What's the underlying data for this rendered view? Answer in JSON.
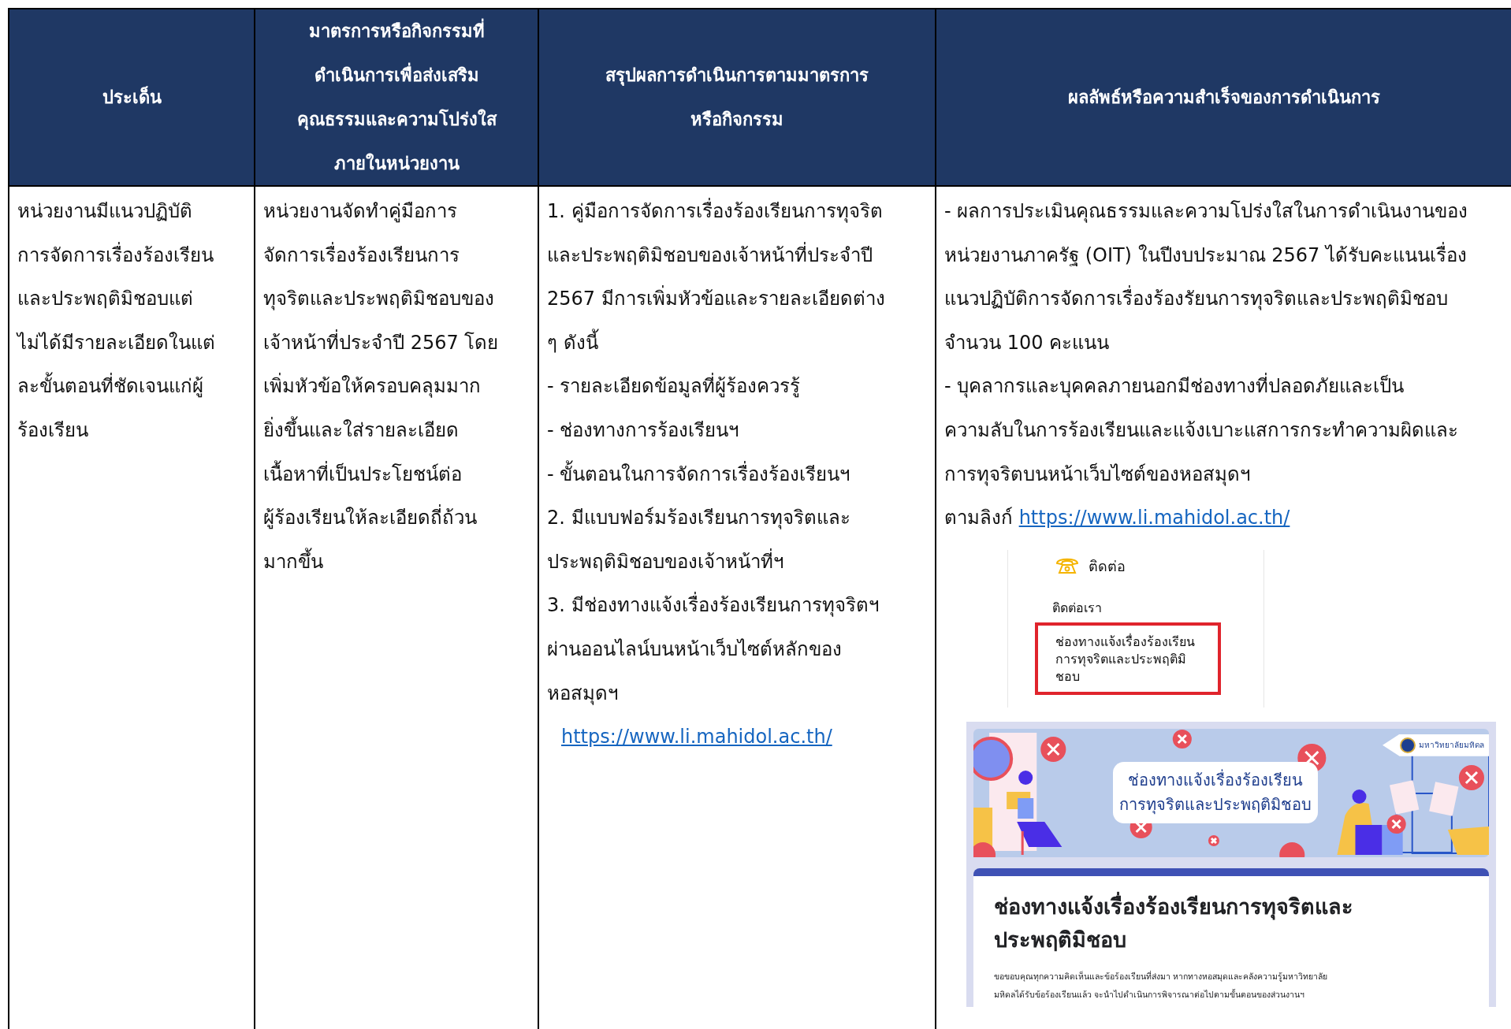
{
  "table": {
    "columns": [
      {
        "lines": [
          "ประเด็น"
        ]
      },
      {
        "lines": [
          "มาตรการหรือกิจกรรมที่",
          "ดำเนินการเพื่อส่งเสริม",
          "คุณธรรมและความโปร่งใส",
          "ภายในหน่วยงาน"
        ]
      },
      {
        "lines": [
          "สรุปผลการดำเนินการตามมาตรการ",
          "หรือกิจกรรม"
        ]
      },
      {
        "lines": [
          "ผลลัพธ์หรือความสำเร็จของการดำเนินการ"
        ]
      }
    ],
    "rows": [
      {
        "cells": [
          {
            "lines": [
              {
                "kind": "text",
                "text": "หน่วยงานมีแนวปฏิบัติ"
              },
              {
                "kind": "text",
                "text": "การจัดการเรื่องร้องเรียน"
              },
              {
                "kind": "text",
                "text": "และประพฤติมิชอบแต่"
              },
              {
                "kind": "text",
                "text": "ไม่ได้มีรายละเอียดในแต่"
              },
              {
                "kind": "text",
                "text": "ละขั้นตอนที่ชัดเจนแก่ผู้"
              },
              {
                "kind": "text",
                "text": "ร้องเรียน"
              }
            ]
          },
          {
            "lines": [
              {
                "kind": "text",
                "text": "หน่วยงานจัดทำคู่มือการ"
              },
              {
                "kind": "text",
                "text": "จัดการเรื่องร้องเรียนการ"
              },
              {
                "kind": "text",
                "text": "ทุจริตและประพฤติมิชอบของ"
              },
              {
                "kind": "text",
                "text": "เจ้าหน้าที่ประจำปี 2567 โดย"
              },
              {
                "kind": "text",
                "text": "เพิ่มหัวข้อให้ครอบคลุมมาก"
              },
              {
                "kind": "text",
                "text": "ยิ่งขึ้นและใส่รายละเอียด"
              },
              {
                "kind": "text",
                "text": "เนื้อหาที่เป็นประโยชน์ต่อ"
              },
              {
                "kind": "text",
                "text": "ผู้ร้องเรียนให้ละเอียดถี่ถ้วน"
              },
              {
                "kind": "text",
                "text": "มากขึ้น"
              }
            ]
          },
          {
            "lines": [
              {
                "kind": "text",
                "text": "1. คู่มือการจัดการเรื่องร้องเรียนการทุจริต"
              },
              {
                "kind": "text",
                "text": "และประพฤติมิชอบของเจ้าหน้าที่ประจำปี"
              },
              {
                "kind": "text",
                "text": "2567 มีการเพิ่มหัวข้อและรายละเอียดต่าง"
              },
              {
                "kind": "text",
                "text": "ๆ ดังนี้"
              },
              {
                "kind": "text",
                "text": "- รายละเอียดข้อมูลที่ผู้ร้องควรรู้"
              },
              {
                "kind": "text",
                "text": "- ช่องทางการร้องเรียนฯ"
              },
              {
                "kind": "text",
                "text": "- ขั้นตอนในการจัดการเรื่องร้องเรียนฯ"
              },
              {
                "kind": "text",
                "text": "2. มีแบบฟอร์มร้องเรียนการทุจริตและ"
              },
              {
                "kind": "text",
                "text": "ประพฤติมิชอบของเจ้าหน้าที่ฯ"
              },
              {
                "kind": "text",
                "text": "3. มีช่องทางแจ้งเรื่องร้องเรียนการทุจริตฯ"
              },
              {
                "kind": "text",
                "text": "ผ่านออนไลน์บนหน้าเว็บไซต์หลักของ"
              },
              {
                "kind": "text",
                "text": "หอสมุดฯ"
              },
              {
                "kind": "link",
                "link": "https://www.li.mahidol.ac.th/"
              }
            ]
          },
          {
            "lines": [
              {
                "kind": "text",
                "text": "- ผลการประเมินคุณธรรมและความโปร่งใสในการดำเนินงานของ"
              },
              {
                "kind": "text",
                "text": "หน่วยงานภาครัฐ (OIT) ในปีงบประมาณ 2567 ได้รับคะแนนเรื่อง"
              },
              {
                "kind": "text",
                "text": "แนวปฏิบัติการจัดการเรื่องร้องรัยนการทุจริตและประพฤติมิชอบ"
              },
              {
                "kind": "text",
                "text": "จำนวน 100 คะแนน"
              },
              {
                "kind": "text",
                "text": "- บุคลากรและบุคคลภายนอกมีช่องทางที่ปลอดภัยและเป็น"
              },
              {
                "kind": "text",
                "text": "ความลับในการร้องเรียนและแจ้งเบาะแสการกระทำความผิดและ"
              },
              {
                "kind": "text",
                "text": "การทุจริตบนหน้าเว็บไซต์ของหอสมุดฯ"
              },
              {
                "kind": "text_link",
                "text": "ตามลิงก์",
                "link": "https://www.li.mahidol.ac.th/"
              }
            ],
            "contact_snippet": {
              "heading": "ติดต่อ",
              "subheading": "ติดต่อเรา",
              "item_lines": [
                "ช่องทางแจ้งเรื่องร้องเรียน",
                "การทุจริตและประพฤติมิ",
                "ชอบ"
              ],
              "highlighted": true
            },
            "form_preview": {
              "banner_lines": [
                "ช่องทางแจ้งเรื่องร้องเรียน",
                "การทุจริตและประพฤติมิชอบ"
              ],
              "logo_text": "มหาวิทยาลัยมหิดล",
              "title_lines": [
                "ช่องทางแจ้งเรื่องร้องเรียนการทุจริตและ",
                "ประพฤติมิชอบ"
              ],
              "description_lines": [
                "ขอขอบคุณทุกความคิดเห็นและข้อร้องเรียนที่ส่งมา หากทางหอสมุดและคลังความรู้มหาวิทยาลัย",
                "มหิดลได้รับข้อร้องเรียนแล้ว จะนำไปดำเนินการพิจารณาต่อไปตามขั้นตอนของส่วนงานฯ"
              ]
            }
          }
        ]
      }
    ]
  }
}
